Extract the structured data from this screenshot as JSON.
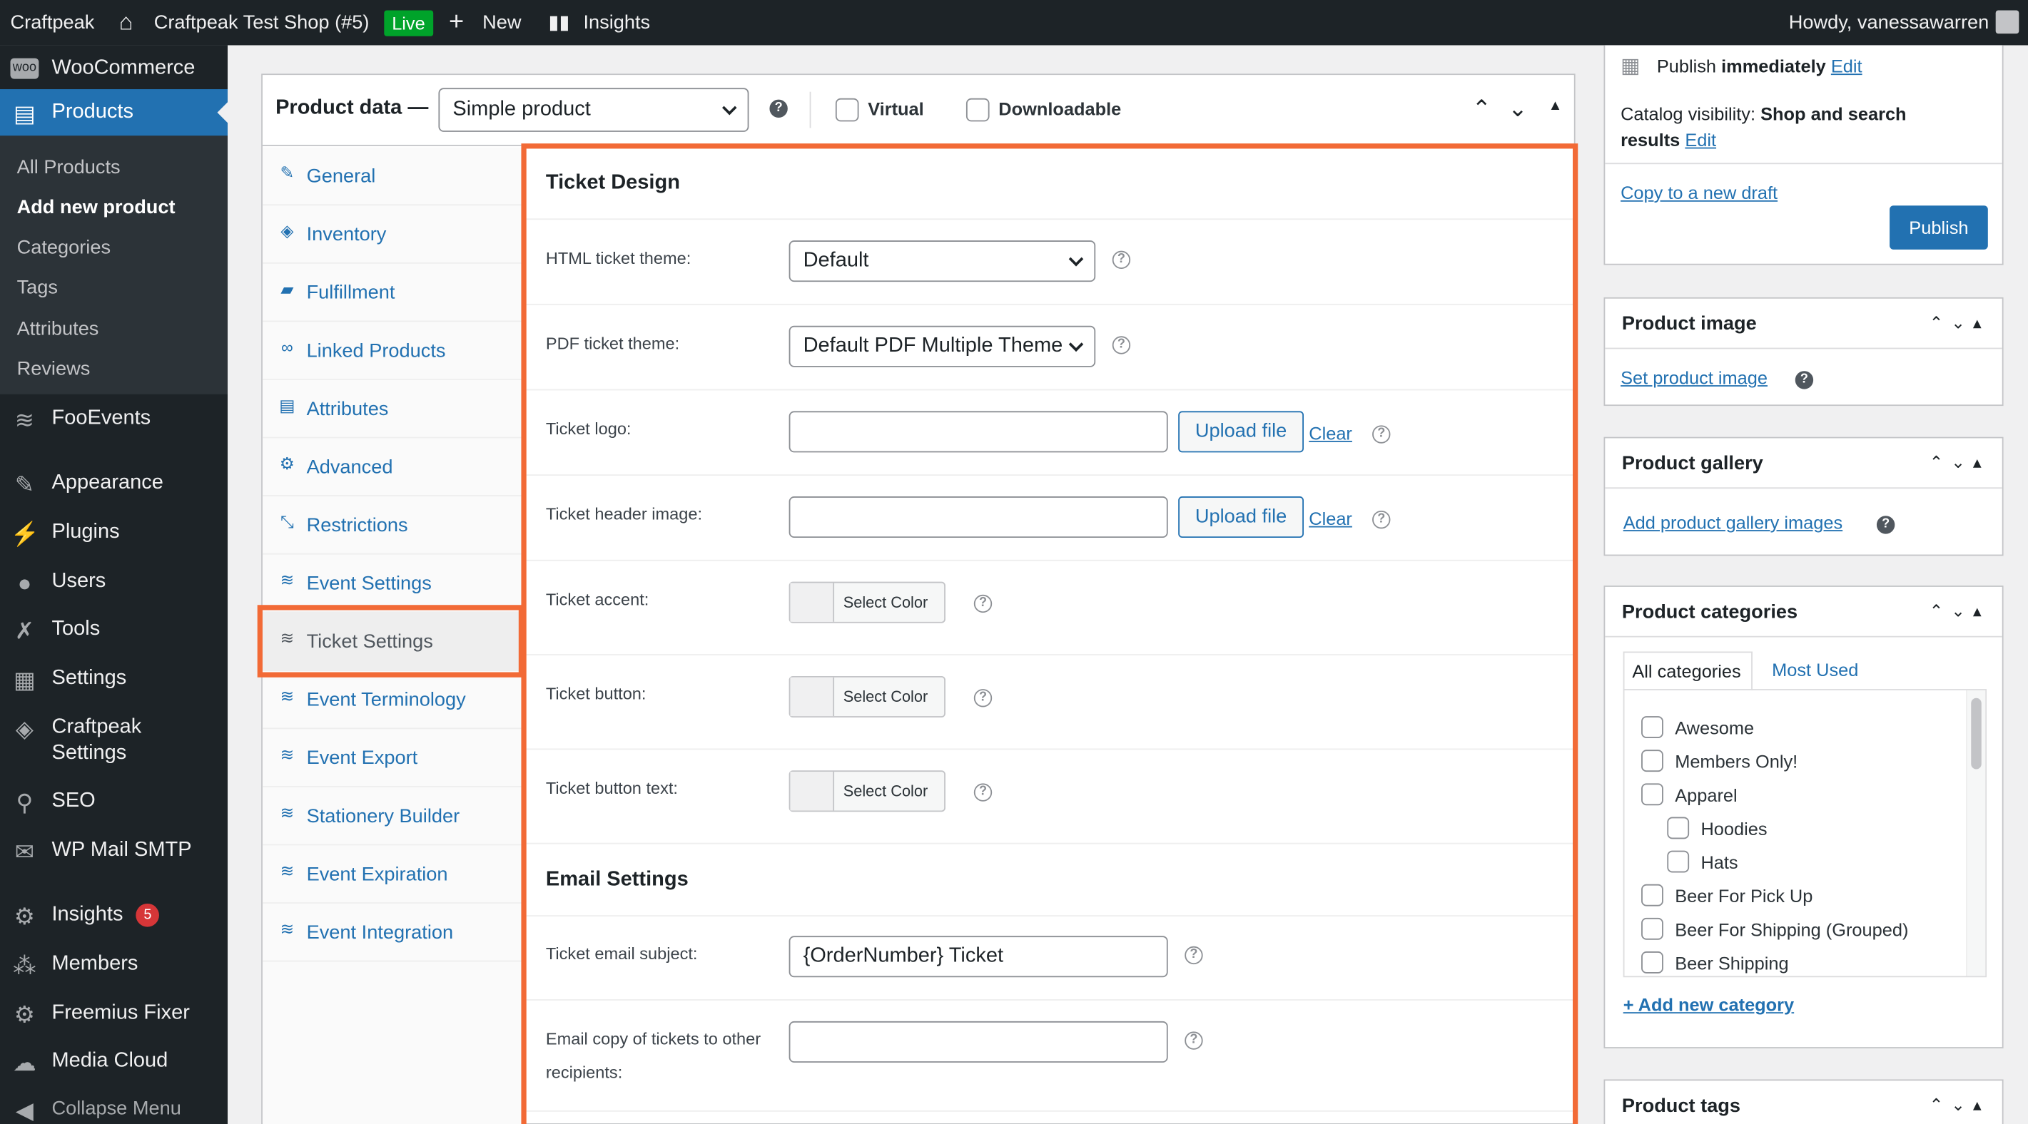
{
  "adminbar": {
    "brand": "Craftpeak",
    "site": "Craftpeak Test Shop (#5)",
    "live": "Live",
    "new": "New",
    "insights": "Insights",
    "howdy": "Howdy, vanessawarren"
  },
  "sidebar": {
    "woocommerce": "WooCommerce",
    "products": "Products",
    "submenu": [
      "All Products",
      "Add new product",
      "Categories",
      "Tags",
      "Attributes",
      "Reviews"
    ],
    "items": [
      {
        "label": "FooEvents"
      },
      {
        "label": "Appearance"
      },
      {
        "label": "Plugins"
      },
      {
        "label": "Users"
      },
      {
        "label": "Tools"
      },
      {
        "label": "Settings"
      },
      {
        "label": "Craftpeak Settings"
      },
      {
        "label": "SEO"
      },
      {
        "label": "WP Mail SMTP"
      },
      {
        "label": "Insights",
        "badge": "5"
      },
      {
        "label": "Members"
      },
      {
        "label": "Freemius Fixer"
      },
      {
        "label": "Media Cloud"
      },
      {
        "label": "Collapse Menu"
      }
    ]
  },
  "product_data": {
    "label": "Product data —",
    "type_value": "Simple product",
    "virtual": "Virtual",
    "downloadable": "Downloadable",
    "tabs": [
      "General",
      "Inventory",
      "Fulfillment",
      "Linked Products",
      "Attributes",
      "Advanced",
      "Restrictions",
      "Event Settings",
      "Ticket Settings",
      "Event Terminology",
      "Event Export",
      "Stationery Builder",
      "Event Expiration",
      "Event Integration"
    ],
    "active_tab": "Ticket Settings"
  },
  "ticket_design": {
    "title": "Ticket Design",
    "html_theme_label": "HTML ticket theme:",
    "html_theme_value": "Default",
    "pdf_theme_label": "PDF ticket theme:",
    "pdf_theme_value": "Default PDF Multiple Theme",
    "logo_label": "Ticket logo:",
    "header_label": "Ticket header image:",
    "upload": "Upload file",
    "clear": "Clear",
    "accent_label": "Ticket accent:",
    "button_label": "Ticket button:",
    "button_text_label": "Ticket button text:",
    "select_color": "Select Color"
  },
  "email_settings": {
    "title": "Email Settings",
    "subject_label": "Ticket email subject:",
    "subject_value": "{OrderNumber} Ticket",
    "copy_label_1": "Email copy of tickets to other",
    "copy_label_2": "recipients:"
  },
  "publish": {
    "publish_prefix": "Publish",
    "publish_strong": "immediately",
    "edit": "Edit",
    "visibility_prefix": "Catalog visibility:",
    "visibility_strong_1": "Shop and search",
    "visibility_strong_2": "results",
    "copy_draft": "Copy to a new draft",
    "publish_button": "Publish"
  },
  "product_image": {
    "title": "Product image",
    "link": "Set product image"
  },
  "product_gallery": {
    "title": "Product gallery",
    "link": "Add product gallery images"
  },
  "product_categories": {
    "title": "Product categories",
    "tab_all": "All categories",
    "tab_used": "Most Used",
    "items": [
      "Awesome",
      "Members Only!",
      "Apparel",
      "Hoodies",
      "Hats",
      "Beer For Pick Up",
      "Beer For Shipping (Grouped)",
      "Beer Shipping"
    ],
    "add_new": "+ Add new category"
  },
  "product_tags": {
    "title": "Product tags"
  },
  "colors": {
    "accent": "#2271b1",
    "highlight": "#f26a36",
    "adminbar": "#1d2327"
  }
}
